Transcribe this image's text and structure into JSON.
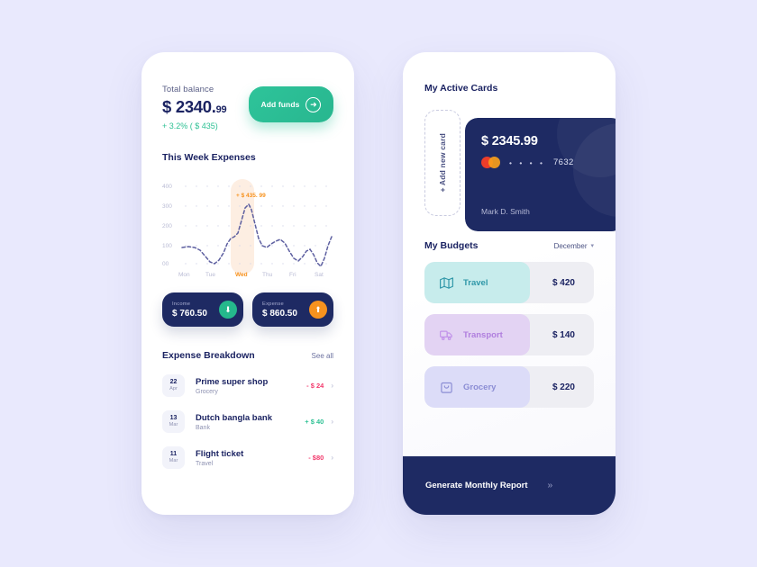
{
  "theme": {
    "background": "#e9e9fd",
    "navy": "#1e2a63",
    "green": "#2ec49a",
    "orange": "#f7921e",
    "red": "#f2386b"
  },
  "left_phone": {
    "total_balance_label": "Total balance",
    "balance_main": "$ 2340.",
    "balance_cents": "99",
    "balance_delta": "+ 3.2% ( $ 435)",
    "add_funds_label": "Add funds",
    "add_funds_icon": "arrow-right-circle-icon",
    "week_title": "This Week Expenses",
    "income": {
      "label": "Income",
      "value": "$ 760.50",
      "icon": "arrow-down-icon"
    },
    "expense": {
      "label": "Expense",
      "value": "$ 860.50",
      "icon": "arrow-up-icon"
    },
    "breakdown_title": "Expense Breakdown",
    "see_all_label": "See all",
    "transactions": [
      {
        "day": "22",
        "month": "Apr",
        "title": "Prime super shop",
        "category": "Grocery",
        "amount": "- $ 24",
        "sign": "neg"
      },
      {
        "day": "13",
        "month": "Mar",
        "title": "Dutch bangla bank",
        "category": "Bank",
        "amount": "+ $ 40",
        "sign": "pos"
      },
      {
        "day": "11",
        "month": "Mar",
        "title": "Flight ticket",
        "category": "Travel",
        "amount": "- $80",
        "sign": "neg"
      }
    ]
  },
  "right_phone": {
    "cards_title": "My Active Cards",
    "add_new_card_label": "+ Add new card",
    "card": {
      "amount": "$ 2345.99",
      "brand_icon": "mastercard-icon",
      "masked_dots": "• • • •",
      "last_four": "7632",
      "holder": "Mark D. Smith"
    },
    "budgets_title": "My Budgets",
    "month_selector": "December",
    "month_caret_icon": "chevron-down-icon",
    "budgets": [
      {
        "label": "Travel",
        "amount": "$ 420",
        "icon": "map-icon",
        "fill_pct": 62,
        "fill_color": "#c7ecec",
        "text_color": "#2f97a8"
      },
      {
        "label": "Transport",
        "amount": "$ 140",
        "icon": "truck-icon",
        "fill_pct": 62,
        "fill_color": "#e3d3f3",
        "text_color": "#b07ede"
      },
      {
        "label": "Grocery",
        "amount": "$ 220",
        "icon": "shopping-bag-icon",
        "fill_pct": 62,
        "fill_color": "#dcdcf8",
        "text_color": "#8b8dd4"
      }
    ],
    "footer_label": "Generate Monthly Report",
    "footer_icon": "double-chevron-right-icon"
  },
  "chart_data": {
    "type": "line",
    "title": "This Week Expenses",
    "xlabel": "",
    "ylabel": "",
    "categories": [
      "Mon",
      "Tue",
      "Wed",
      "Thu",
      "Fri",
      "Sat"
    ],
    "ytick_labels": [
      "400",
      "300",
      "200",
      "100",
      "00"
    ],
    "ylim": [
      0,
      400
    ],
    "grid": "dotted",
    "highlight": {
      "category": "Wed",
      "annotation": "+ $ 435. 99",
      "band_color": "#fdeee0"
    },
    "series": [
      {
        "name": "Expenses",
        "style": "dashed",
        "color": "#5d5fa0",
        "x": [
          0,
          4,
          8,
          12,
          16,
          20,
          24,
          28,
          32,
          36,
          40,
          44,
          48,
          52,
          56,
          60,
          64,
          68,
          72,
          76,
          80,
          84,
          88,
          92,
          96,
          100
        ],
        "values": [
          128,
          130,
          129,
          126,
          118,
          75,
          38,
          62,
          140,
          196,
          190,
          205,
          250,
          300,
          285,
          200,
          110,
          100,
          118,
          140,
          146,
          100,
          60,
          85,
          120,
          95,
          40,
          20,
          95,
          180,
          215,
          200
        ]
      }
    ]
  }
}
